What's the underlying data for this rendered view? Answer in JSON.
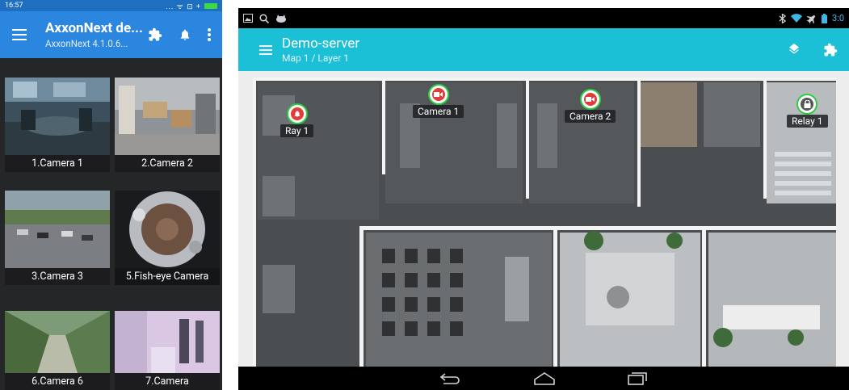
{
  "phone": {
    "status": {
      "time": "16:57",
      "right": "... ᯤ ⊡ +"
    },
    "appbar": {
      "title": "AxxonNext de...",
      "subtitle": "AxxonNext 4.1.0.6...",
      "icons": [
        "menu-icon",
        "puzzle-icon",
        "bell-icon",
        "more-vert-icon"
      ]
    },
    "cameras": [
      {
        "label": "1.Camera 1"
      },
      {
        "label": "2.Camera 2"
      },
      {
        "label": "3.Camera 3"
      },
      {
        "label": "5.Fish-eye Camera"
      },
      {
        "label": "6.Camera 6"
      },
      {
        "label": "7.Camera"
      }
    ]
  },
  "tablet": {
    "status": {
      "time": "3:0",
      "left_icons": [
        "image-icon",
        "search-icon",
        "cat-icon"
      ],
      "right_icons": [
        "bluetooth-icon",
        "wifi-icon",
        "airplane-icon",
        "battery-icon"
      ]
    },
    "appbar": {
      "title": "Demo-server",
      "subtitle": "Map 1 / Layer 1",
      "icons": [
        "menu-icon",
        "layers-icon",
        "puzzle-icon"
      ]
    },
    "markers": [
      {
        "label": "Ray 1",
        "kind": "alarm",
        "color": "#e03c3c"
      },
      {
        "label": "Camera 1",
        "kind": "camera",
        "color": "#e03c3c"
      },
      {
        "label": "Camera 2",
        "kind": "camera",
        "color": "#e03c3c"
      },
      {
        "label": "Relay 1",
        "kind": "relay",
        "color": "#555555"
      }
    ],
    "navbar": {
      "icons": [
        "back-icon",
        "home-icon",
        "recents-icon"
      ]
    }
  },
  "colors": {
    "phone_appbar": "#2b86e0",
    "tablet_appbar": "#1cc0d6",
    "marker_ring": "#2ecc40"
  }
}
